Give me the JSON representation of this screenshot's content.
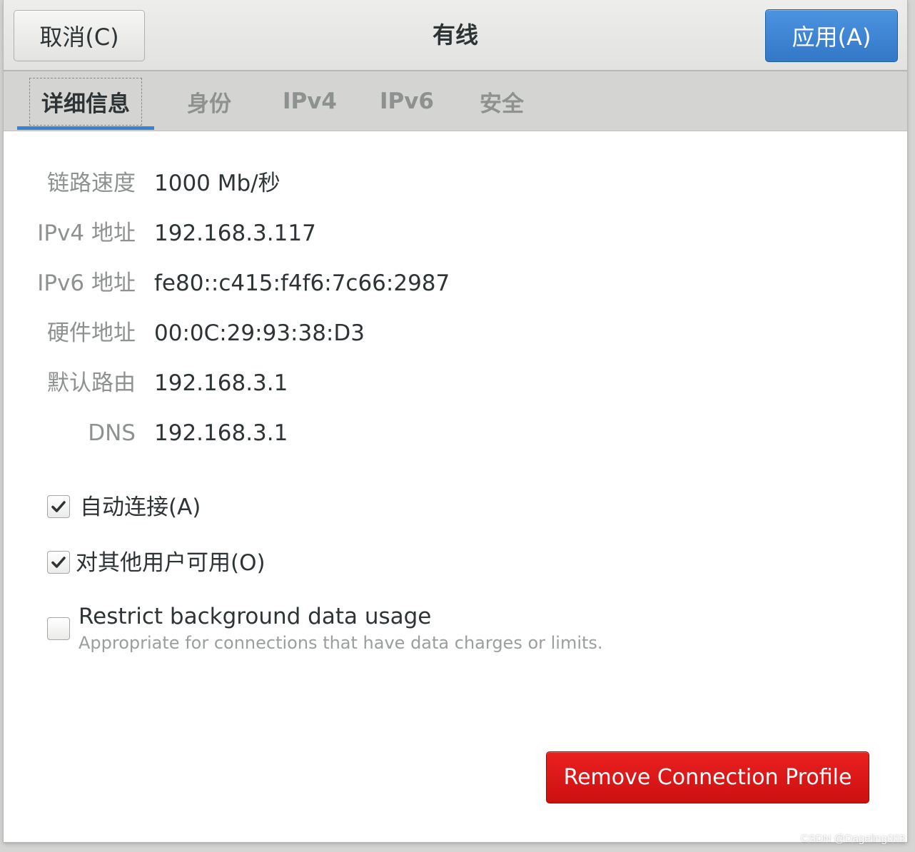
{
  "header": {
    "cancel_label": "取消(C)",
    "title": "有线",
    "apply_label": "应用(A)"
  },
  "tabs": [
    {
      "label": "详细信息",
      "active": true
    },
    {
      "label": "身份",
      "active": false
    },
    {
      "label": "IPv4",
      "active": false
    },
    {
      "label": "IPv6",
      "active": false
    },
    {
      "label": "安全",
      "active": false
    }
  ],
  "details": [
    {
      "label": "链路速度",
      "value": "1000 Mb/秒"
    },
    {
      "label": "IPv4 地址",
      "value": "192.168.3.117"
    },
    {
      "label": "IPv6 地址",
      "value": "fe80::c415:f4f6:7c66:2987"
    },
    {
      "label": "硬件地址",
      "value": "00:0C:29:93:38:D3"
    },
    {
      "label": "默认路由",
      "value": "192.168.3.1"
    },
    {
      "label": "DNS",
      "value": "192.168.3.1"
    }
  ],
  "options": {
    "auto_connect": {
      "label": "自动连接(A)",
      "checked": true
    },
    "all_users": {
      "label": "对其他用户可用(O)",
      "checked": true
    },
    "restrict_bg": {
      "label": "Restrict background data usage",
      "description": "Appropriate for connections that have data charges or limits.",
      "checked": false
    }
  },
  "remove_label": "Remove Connection Profile",
  "watermark": "CSDN @Dageling003",
  "colors": {
    "apply": "#3b83d1",
    "remove": "#e01818",
    "tab_indicator": "#3b83d1"
  }
}
